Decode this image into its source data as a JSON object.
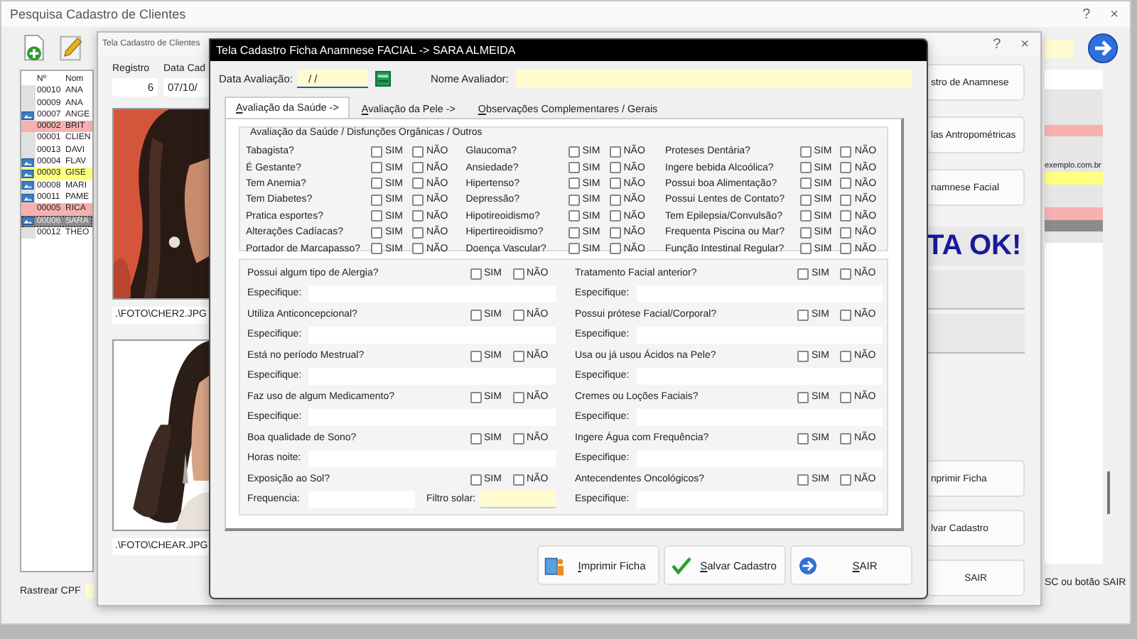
{
  "search_window": {
    "title": "Pesquisa Cadastro de Clientes",
    "help": "?",
    "close": "×",
    "client_list": {
      "columns": [
        "Nº",
        "Nom"
      ],
      "rows": [
        {
          "number": "00010",
          "name": "ANA",
          "color": "#ffffff",
          "photo": false,
          "selected": false
        },
        {
          "number": "00009",
          "name": "ANA",
          "color": "#ffffff",
          "photo": false,
          "selected": false
        },
        {
          "number": "00007",
          "name": "ANGE",
          "color": "#ffffff",
          "photo": true,
          "selected": false
        },
        {
          "number": "00002",
          "name": "BRIT",
          "color": "#f7b0b0",
          "photo": false,
          "selected": false
        },
        {
          "number": "00001",
          "name": "CLIEN",
          "color": "#ffffff",
          "photo": false,
          "selected": false
        },
        {
          "number": "00013",
          "name": "DAVI",
          "color": "#ffffff",
          "photo": false,
          "selected": false
        },
        {
          "number": "00004",
          "name": "FLAV",
          "color": "#ffffff",
          "photo": true,
          "selected": false,
          "email": "exemplo.com.br"
        },
        {
          "number": "00003",
          "name": "GISE",
          "color": "#ffff80",
          "photo": true,
          "selected": false
        },
        {
          "number": "00008",
          "name": "MARI",
          "color": "#ffffff",
          "photo": true,
          "selected": false
        },
        {
          "number": "00011",
          "name": "PAME",
          "color": "#ffffff",
          "photo": true,
          "selected": false
        },
        {
          "number": "00005",
          "name": "RICA",
          "color": "#f7b0b0",
          "photo": false,
          "selected": false
        },
        {
          "number": "00006",
          "name": "SARA",
          "color": "#8c8c8c",
          "photo": true,
          "selected": true
        },
        {
          "number": "00012",
          "name": "THEO",
          "color": "#ffffff",
          "photo": false,
          "selected": false
        }
      ]
    },
    "track_label": "Rastrear CPF",
    "hint_fragment": "SC ou botão SAIR"
  },
  "client_window": {
    "title": "Tela Cadastro de Clientes",
    "help": "?",
    "close": "×",
    "registro_label": "Registro",
    "registro_value": "6",
    "date_label": "Data Cad",
    "date_value": "07/10/",
    "photos": [
      {
        "kind": "picture",
        "path": ".\\FOTO\\CHER2.JPG"
      },
      {
        "kind": "picture",
        "path": ".\\FOTO\\CHEAR.JPG"
      }
    ],
    "side_top": [
      {
        "kind": "button",
        "label": "stro de Anamnese"
      },
      {
        "kind": "button",
        "label": "las Antropométricas"
      },
      {
        "kind": "button",
        "label": "namnese Facial"
      },
      {
        "kind": "banner",
        "label": "TA OK!"
      },
      {
        "kind": "blank"
      },
      {
        "kind": "blank"
      }
    ],
    "side_bottom": [
      {
        "kind": "button",
        "label": "nprimir Ficha"
      },
      {
        "kind": "button",
        "label": "lvar Cadastro"
      },
      {
        "kind": "button",
        "label": "SAIR"
      }
    ]
  },
  "anamnese_window": {
    "title": "Tela Cadastro Ficha Anamnese FACIAL -> SARA ALMEIDA",
    "date_label": "Data Avaliação:",
    "date_value": "/ /",
    "evaluator_label": "Nome Avaliador:",
    "tabs": [
      {
        "label": "Avaliação da Saúde ->",
        "selected": true
      },
      {
        "label": "Avaliação da Pele ->",
        "selected": false
      },
      {
        "label": "Observações Complementares / Gerais",
        "selected": false
      }
    ],
    "health_group": {
      "title": "Avaliação da Saúde / Disfunções Orgânicas / Outros",
      "columns": [
        [
          {
            "label": "Tabagista?",
            "options": [
              {
                "label": "SIM",
                "checked": false
              },
              {
                "label": "NÃO",
                "checked": false
              }
            ]
          },
          {
            "label": "É Gestante?",
            "options": [
              {
                "label": "SIM",
                "checked": false
              },
              {
                "label": "NÃO",
                "checked": false
              }
            ]
          },
          {
            "label": "Tem Anemia?",
            "options": [
              {
                "label": "SIM",
                "checked": false
              },
              {
                "label": "NÃO",
                "checked": false
              }
            ]
          },
          {
            "label": "Tem Diabetes?",
            "options": [
              {
                "label": "SIM",
                "checked": false
              },
              {
                "label": "NÃO",
                "checked": false
              }
            ]
          },
          {
            "label": "Pratica esportes?",
            "options": [
              {
                "label": "SIM",
                "checked": false
              },
              {
                "label": "NÃO",
                "checked": false
              }
            ]
          },
          {
            "label": "Alterações Cadíacas?",
            "options": [
              {
                "label": "SIM",
                "checked": false
              },
              {
                "label": "NÃO",
                "checked": false
              }
            ]
          },
          {
            "label": "Portador de Marcapasso?",
            "options": [
              {
                "label": "SIM",
                "checked": false
              },
              {
                "label": "NÃO",
                "checked": false
              }
            ]
          }
        ],
        [
          {
            "label": "Glaucoma?",
            "options": [
              {
                "label": "SIM",
                "checked": false
              },
              {
                "label": "NÃO",
                "checked": false
              }
            ]
          },
          {
            "label": "Ansiedade?",
            "options": [
              {
                "label": "SIM",
                "checked": false
              },
              {
                "label": "NÃO",
                "checked": false
              }
            ]
          },
          {
            "label": "Hipertenso?",
            "options": [
              {
                "label": "SIM",
                "checked": false
              },
              {
                "label": "NÃO",
                "checked": false
              }
            ]
          },
          {
            "label": "Depressão?",
            "options": [
              {
                "label": "SIM",
                "checked": false
              },
              {
                "label": "NÃO",
                "checked": false
              }
            ]
          },
          {
            "label": "Hipotireoidismo?",
            "options": [
              {
                "label": "SIM",
                "checked": false
              },
              {
                "label": "NÃO",
                "checked": false
              }
            ]
          },
          {
            "label": "Hipertireoidismo?",
            "options": [
              {
                "label": "SIM",
                "checked": false
              },
              {
                "label": "NÃO",
                "checked": false
              }
            ]
          },
          {
            "label": "Doença Vascular?",
            "options": [
              {
                "label": "SIM",
                "checked": false
              },
              {
                "label": "NÃO",
                "checked": false
              }
            ]
          }
        ],
        [
          {
            "label": "Proteses Dentária?",
            "options": [
              {
                "label": "SIM",
                "checked": false
              },
              {
                "label": "NÃO",
                "checked": false
              }
            ]
          },
          {
            "label": "Ingere bebida Alcoólica?",
            "options": [
              {
                "label": "SIM",
                "checked": false
              },
              {
                "label": "NÃO",
                "checked": false
              }
            ]
          },
          {
            "label": "Possui boa Alimentação?",
            "options": [
              {
                "label": "SIM",
                "checked": false
              },
              {
                "label": "NÃO",
                "checked": false
              }
            ]
          },
          {
            "label": "Possui Lentes de Contato?",
            "options": [
              {
                "label": "SIM",
                "checked": false
              },
              {
                "label": "NÃO",
                "checked": false
              }
            ]
          },
          {
            "label": "Tem Epilepsia/Convulsão?",
            "options": [
              {
                "label": "SIM",
                "checked": false
              },
              {
                "label": "NÃO",
                "checked": false
              }
            ]
          },
          {
            "label": "Frequenta Piscina ou Mar?",
            "options": [
              {
                "label": "SIM",
                "checked": false
              },
              {
                "label": "NÃO",
                "checked": false
              }
            ]
          },
          {
            "label": "Função Intestinal Regular?",
            "options": [
              {
                "label": "SIM",
                "checked": false
              },
              {
                "label": "NÃO",
                "checked": false
              }
            ]
          }
        ]
      ]
    },
    "details": [
      [
        {
          "question": "Possui algum tipo de Alergia?",
          "options": [
            {
              "label": "SIM",
              "checked": false
            },
            {
              "label": "NÃO",
              "checked": false
            }
          ],
          "fields": [
            {
              "label": "Especifique:",
              "highlighted": false
            }
          ]
        },
        {
          "question": "Utiliza Anticoncepcional?",
          "options": [
            {
              "label": "SIM",
              "checked": false
            },
            {
              "label": "NÃO",
              "checked": false
            }
          ],
          "fields": [
            {
              "label": "Especifique:",
              "highlighted": false
            }
          ]
        },
        {
          "question": "Está no período Mestrual?",
          "options": [
            {
              "label": "SIM",
              "checked": false
            },
            {
              "label": "NÃO",
              "checked": false
            }
          ],
          "fields": [
            {
              "label": "Especifique:",
              "highlighted": false
            }
          ]
        },
        {
          "question": "Faz uso de algum Medicamento?",
          "options": [
            {
              "label": "SIM",
              "checked": false
            },
            {
              "label": "NÃO",
              "checked": false
            }
          ],
          "fields": [
            {
              "label": "Especifique:",
              "highlighted": false
            }
          ]
        },
        {
          "question": "Boa qualidade de Sono?",
          "options": [
            {
              "label": "SIM",
              "checked": false
            },
            {
              "label": "NÃO",
              "checked": false
            }
          ],
          "fields": [
            {
              "label": "Horas noite:",
              "highlighted": false
            }
          ]
        },
        {
          "question": "Exposição ao Sol?",
          "options": [
            {
              "label": "SIM",
              "checked": false
            },
            {
              "label": "NÃO",
              "checked": false
            }
          ],
          "fields": [
            {
              "label": "Frequencia:",
              "highlighted": false
            },
            {
              "label": "Filtro solar:",
              "highlighted": true
            }
          ]
        }
      ],
      [
        {
          "question": "Tratamento Facial anterior?",
          "options": [
            {
              "label": "SIM",
              "checked": false
            },
            {
              "label": "NÃO",
              "checked": false
            }
          ],
          "fields": [
            {
              "label": "Especifique:",
              "highlighted": false
            }
          ]
        },
        {
          "question": "Possui prótese Facial/Corporal?",
          "options": [
            {
              "label": "SIM",
              "checked": false
            },
            {
              "label": "NÃO",
              "checked": false
            }
          ],
          "fields": [
            {
              "label": "Especifique:",
              "highlighted": false
            }
          ]
        },
        {
          "question": "Usa ou já usou Ácidos na Pele?",
          "options": [
            {
              "label": "SIM",
              "checked": false
            },
            {
              "label": "NÃO",
              "checked": false
            }
          ],
          "fields": [
            {
              "label": "Especifique:",
              "highlighted": false
            }
          ]
        },
        {
          "question": "Cremes ou Loções Faciais?",
          "options": [
            {
              "label": "SIM",
              "checked": false
            },
            {
              "label": "NÃO",
              "checked": false
            }
          ],
          "fields": [
            {
              "label": "Especifique:",
              "highlighted": false
            }
          ]
        },
        {
          "question": "Ingere Água com Frequência?",
          "options": [
            {
              "label": "SIM",
              "checked": false
            },
            {
              "label": "NÃO",
              "checked": false
            }
          ],
          "fields": [
            {
              "label": "Especifique:",
              "highlighted": false
            }
          ]
        },
        {
          "question": "Antecendentes Oncológicos?",
          "options": [
            {
              "label": "SIM",
              "checked": false
            },
            {
              "label": "NÃO",
              "checked": false
            }
          ],
          "fields": [
            {
              "label": "Especifique:",
              "highlighted": false
            }
          ]
        }
      ]
    ],
    "buttons": [
      {
        "label": "Imprimir Ficha"
      },
      {
        "label": "Salvar Cadastro"
      },
      {
        "label": "SAIR"
      }
    ]
  }
}
